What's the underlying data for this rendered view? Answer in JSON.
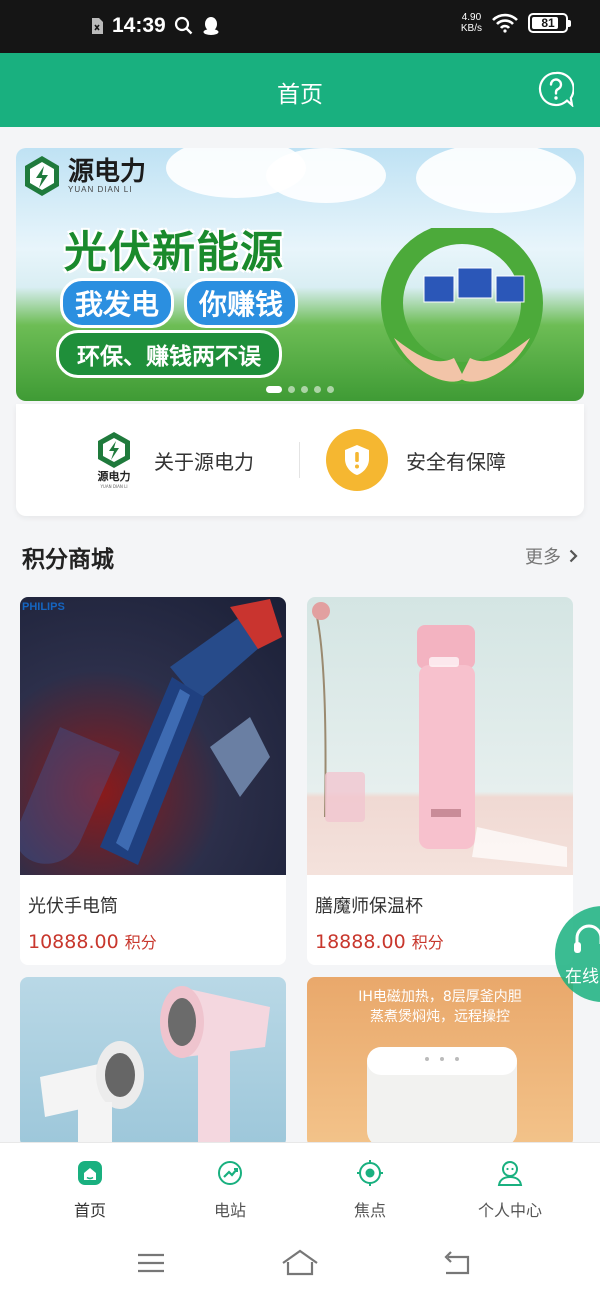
{
  "status_bar": {
    "time": "14:39",
    "net_speed": "4.90",
    "net_unit": "KB/s",
    "battery": "81",
    "battery_level": 0.81
  },
  "header": {
    "title": "首页"
  },
  "banner": {
    "brand_cn": "源电力",
    "brand_en": "YUAN DIAN LI",
    "headline": "光伏新能源",
    "pill_1": "我发电",
    "pill_2": "你赚钱",
    "tagline": "环保、赚钱两不误",
    "slide_count": 5,
    "active_slide": 1
  },
  "info": {
    "logo_cn": "源电力",
    "logo_en": "YUAN DIAN LI",
    "about_label": "关于源电力",
    "safety_label": "安全有保障"
  },
  "mall": {
    "title": "积分商城",
    "more": "更多",
    "products": [
      {
        "name": "光伏手电筒",
        "price": "10888.00",
        "unit": "积分",
        "brand": "PHILIPS"
      },
      {
        "name": "膳魔师保温杯",
        "price": "18888.00",
        "unit": "积分"
      },
      {
        "name": "",
        "price": "",
        "unit": ""
      },
      {
        "name": "",
        "price": "",
        "unit": "",
        "caption_1": "IH电磁加热，8层厚釜内胆",
        "caption_2": "蒸煮煲焖炖，远程操控"
      }
    ]
  },
  "online": "在线",
  "tabs": [
    {
      "label": "首页",
      "icon": "home-icon",
      "active": true
    },
    {
      "label": "电站",
      "icon": "station-icon",
      "active": false
    },
    {
      "label": "焦点",
      "icon": "focus-icon",
      "active": false
    },
    {
      "label": "个人中心",
      "icon": "user-icon",
      "active": false
    }
  ],
  "colors": {
    "primary": "#19b07f",
    "price": "#c8372d",
    "shield": "#f5b731"
  }
}
